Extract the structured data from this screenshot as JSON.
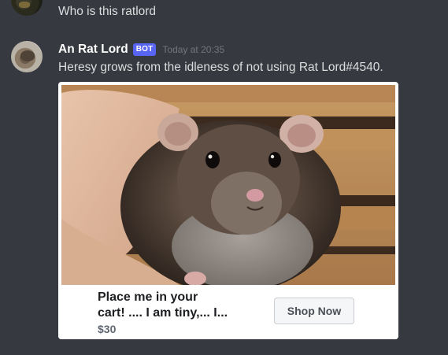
{
  "previous_message": {
    "text": "Who is this ratlord"
  },
  "message": {
    "username": "An Rat Lord",
    "badge": "BOT",
    "timestamp": "Today at 20:35",
    "content": "Heresy grows from the idleness of not using Rat Lord#4540.",
    "embed": {
      "image_icon": "rat-photo",
      "ad_title_lines": [
        "Place me in your",
        "cart! .... I am tiny,... I..."
      ],
      "price": "$30",
      "button_label": "Shop Now"
    }
  },
  "colors": {
    "background": "#36393f",
    "username": "#ffffff",
    "text": "#dcddde",
    "timestamp": "#72767d",
    "bot_badge": "#5865f2",
    "embed_bg": "#ffffff"
  }
}
